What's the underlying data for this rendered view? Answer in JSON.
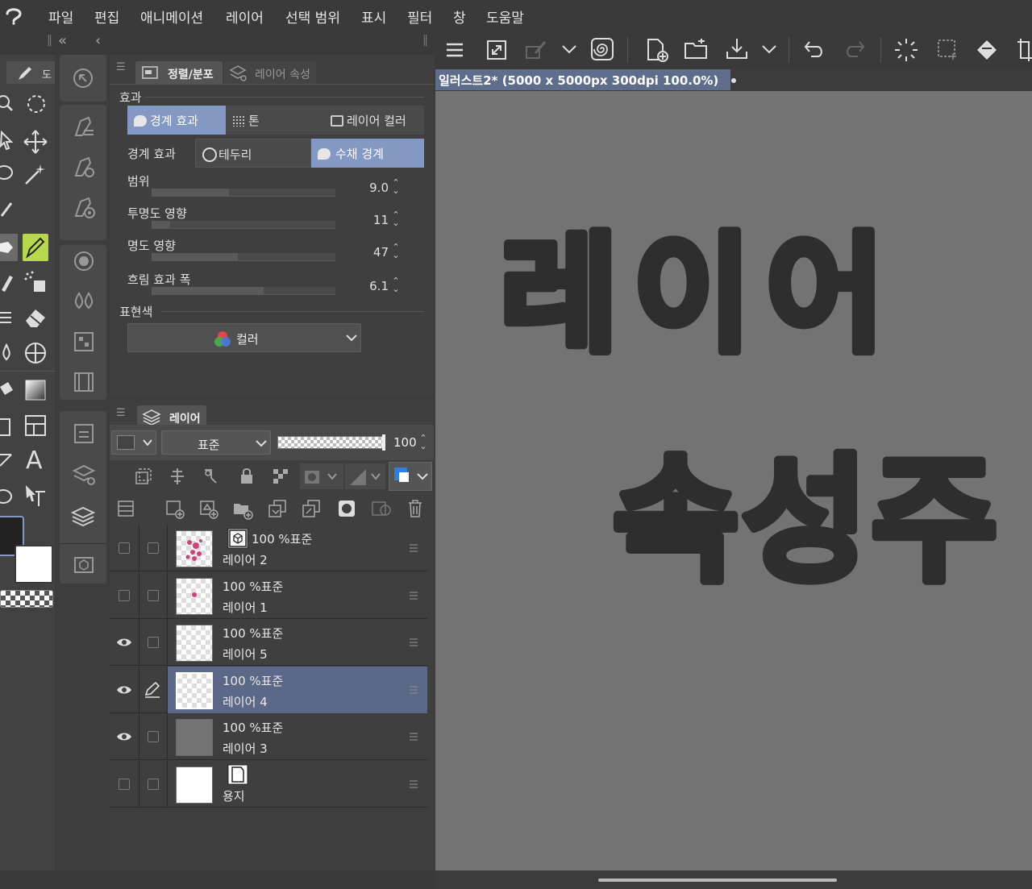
{
  "menu": [
    "파일",
    "편집",
    "애니메이션",
    "레이어",
    "선택 범위",
    "표시",
    "필터",
    "창",
    "도움말"
  ],
  "prop_tabs": {
    "active": "정렬/분포",
    "inactive": "레이어 속성"
  },
  "effect": {
    "section_label": "효과",
    "buttons": [
      "경계 효과",
      "톤",
      "레이어 컬러"
    ],
    "border_label": "경계 효과",
    "border_options": [
      "테두리",
      "수채 경계"
    ]
  },
  "sliders": [
    {
      "label": "범위",
      "value": "9.0",
      "fraction": 0.42
    },
    {
      "label": "투명도 영향",
      "value": "11",
      "fraction": 0.1
    },
    {
      "label": "명도 영향",
      "value": "47",
      "fraction": 0.47
    },
    {
      "label": "흐림 효과 폭",
      "value": "6.1",
      "fraction": 0.61
    }
  ],
  "expression": {
    "label": "표현색",
    "value": "컬러"
  },
  "layer_panel": {
    "title": "레이어",
    "blend_mode": "표준",
    "opacity": "100",
    "layers": [
      {
        "mode": "100 %표준",
        "name": "레이어 2",
        "visible": false,
        "selected": false,
        "thumb": "pink"
      },
      {
        "mode": "100 %표준",
        "name": "레이어 1",
        "visible": false,
        "selected": false,
        "thumb": "dot"
      },
      {
        "mode": "100 %표준",
        "name": "레이어 5",
        "visible": true,
        "selected": false,
        "thumb": "empty"
      },
      {
        "mode": "100 %표준",
        "name": "레이어 4",
        "visible": true,
        "selected": true,
        "thumb": "empty"
      },
      {
        "mode": "100 %표준",
        "name": "레이어 3",
        "visible": true,
        "selected": false,
        "thumb": "gray"
      },
      {
        "mode": "",
        "name": "용지",
        "visible": false,
        "selected": false,
        "thumb": "white"
      }
    ]
  },
  "canvas": {
    "tab_title": "일러스트2* (5000 x 5000px 300dpi 100.0%)",
    "handwriting_line1": "레이어",
    "handwriting_line2": "속성주"
  },
  "colors": {
    "accent": "#8399c4",
    "selected_row": "#5b6887",
    "canvas_bg": "#737373",
    "panel_bg": "#3f3f3f",
    "tool_highlight": "#b7d94a"
  }
}
